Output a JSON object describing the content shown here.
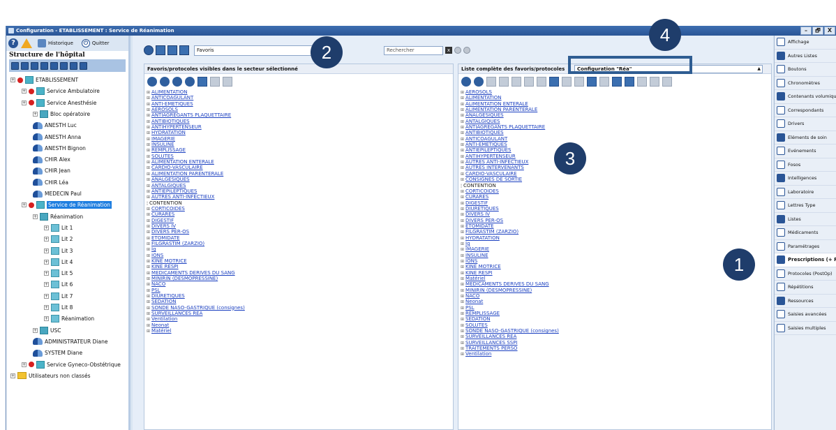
{
  "window": {
    "title": "Configuration - ETABLISSEMENT : Service de Réanimation",
    "controls": [
      "–",
      "🗗",
      "X"
    ]
  },
  "toolbar": {
    "historique": "Historique",
    "quitter": "Quitter"
  },
  "left": {
    "structure_label": "Structure de l'hôpital",
    "tree": [
      {
        "label": "ETABLISSEMENT",
        "level": 0,
        "icon": "hospital"
      },
      {
        "label": "Service Ambulatoire",
        "level": 1,
        "icon": "building"
      },
      {
        "label": "Service Anesthésie",
        "level": 1,
        "icon": "building"
      },
      {
        "label": "Bloc opératoire",
        "level": 2,
        "icon": "room"
      },
      {
        "label": "ANESTH Luc",
        "level": 2,
        "icon": "user"
      },
      {
        "label": "ANESTH Anna",
        "level": 2,
        "icon": "user"
      },
      {
        "label": "ANESTH Bignon",
        "level": 2,
        "icon": "user"
      },
      {
        "label": "CHIR Alex",
        "level": 2,
        "icon": "user"
      },
      {
        "label": "CHIR Jean",
        "level": 2,
        "icon": "user"
      },
      {
        "label": "CHIR Léa",
        "level": 2,
        "icon": "user"
      },
      {
        "label": "MEDECIN Paul",
        "level": 2,
        "icon": "user"
      },
      {
        "label": "Service de Réanimation",
        "level": 1,
        "icon": "building",
        "selected": true
      },
      {
        "label": "Réanimation",
        "level": 2,
        "icon": "room"
      },
      {
        "label": "Lit 1",
        "level": 3,
        "icon": "bed"
      },
      {
        "label": "Lit 2",
        "level": 3,
        "icon": "bed"
      },
      {
        "label": "Lit 3",
        "level": 3,
        "icon": "bed"
      },
      {
        "label": "Lit 4",
        "level": 3,
        "icon": "bed"
      },
      {
        "label": "Lit 5",
        "level": 3,
        "icon": "bed"
      },
      {
        "label": "Lit 6",
        "level": 3,
        "icon": "bed"
      },
      {
        "label": "Lit 7",
        "level": 3,
        "icon": "bed"
      },
      {
        "label": "Lit 8",
        "level": 3,
        "icon": "bed"
      },
      {
        "label": "Réanimation",
        "level": 3,
        "icon": "bed"
      },
      {
        "label": "USC",
        "level": 2,
        "icon": "room"
      },
      {
        "label": "ADMINISTRATEUR Diane",
        "level": 2,
        "icon": "user"
      },
      {
        "label": "SYSTEM Diane",
        "level": 2,
        "icon": "user"
      },
      {
        "label": "Service Gyneco-Obstétrique",
        "level": 1,
        "icon": "building"
      },
      {
        "label": "Utilisateurs non classés",
        "level": 0,
        "icon": "folder"
      }
    ]
  },
  "center": {
    "favoris_value": "Favoris",
    "search_placeholder": "Rechercher",
    "left_panel_title": "Favoris/protocoles visibles dans le secteur sélectionné",
    "right_panel_title": "Liste complète des favoris/protocoles",
    "config_value": "Configuration \"Réa\"",
    "left_items": [
      "ALIMENTATION",
      "ANTICOAGULANT",
      "ANTI-EMETIQUES",
      "AEROSOLS",
      "ANTIAGREGANTS PLAQUETTAIRE",
      "ANTIBIOTIQUES",
      "ANTIHYPERTENSEUR",
      "HYDRATATION",
      "IMAGERIE",
      "INSULINE",
      "REMPLISSAGE",
      "SOLUTES",
      "ALIMENTATION ENTERALE",
      "CARDIO-VASCULAIRE",
      "ALIMENTATION PARENTERALE",
      "ANALGESIQUES",
      "ANTALGIQUES",
      "ANTIEPILEPTIQUES",
      "AUTRES ANTI-INFECTIEUX",
      "CONTENTION",
      "CORTICOIDES",
      "CURARES",
      "DIGESTIF",
      "DIVERS IV",
      "DIVERS PER-OS",
      "ETOMIDATE",
      "FILGRASTIM (ZARZIO)",
      "Ig",
      "IONS",
      "KINE MOTRICE",
      "KINE RESPI",
      "MEDICAMENTS DERIVES DU SANG",
      "MINIRIN (DESMOPRESSINE)",
      "NACO",
      "PSL",
      "DIURETIQUES",
      "SEDATION",
      "SONDE NASO-GASTRIQUE (consignes)",
      "SURVEILLANCES REA",
      "Ventilation",
      "Neonat",
      "Matériel"
    ],
    "right_items": [
      "AEROSOLS",
      "ALIMENTATION",
      "ALIMENTATION ENTERALE",
      "ALIMENTATION PARENTERALE",
      "ANALGESIQUES",
      "ANTALGIQUES",
      "ANTIAGREGANTS PLAQUETTAIRE",
      "ANTIBIOTIQUES",
      "ANTICOAGULANT",
      "ANTI-EMETIQUES",
      "ANTIEPILEPTIQUES",
      "ANTIHYPERTENSEUR",
      "AUTRES ANTI-INFECTIEUX",
      "AUTRES INTERVENANTS",
      "CARDIO-VASCULAIRE",
      "CONSIGNES DE SORTIE",
      "CONTENTION",
      "CORTICOIDES",
      "CURARES",
      "DIGESTIF",
      "DIURETIQUES",
      "DIVERS IV",
      "DIVERS PER-OS",
      "ETOMIDATE",
      "FILGRASTIM (ZARZIO)",
      "HYDRATATION",
      "Ig",
      "IMAGERIE",
      "INSULINE",
      "IONS",
      "KINE MOTRICE",
      "KINE RESPI",
      "Matériel",
      "MEDICAMENTS DERIVES DU SANG",
      "MINIRIN (DESMOPRESSINE)",
      "NACO",
      "Neonat",
      "PSL",
      "REMPLISSAGE",
      "SEDATION",
      "SOLUTES",
      "SONDE NASO-GASTRIQUE (consignes)",
      "SURVEILLANCES REA",
      "SURVEILLANCES SSPI",
      "TRAITEMENTS PERSO",
      "Ventilation"
    ]
  },
  "right": {
    "items": [
      "Affichage",
      "Autres Listes",
      "Boutons",
      "Chronomètres",
      "Contenants volumiques",
      "Correspondants",
      "Drivers",
      "Eléments de soin",
      "Evénements",
      "Fosos",
      "Intelligences",
      "Laboratoire",
      "Lettres Type",
      "Listes",
      "Médicaments",
      "Paramétrages",
      "Prescriptions (+ Favoris)",
      "Protocoles (PostOp)",
      "Répétitions",
      "Ressources",
      "Saisies avancées",
      "Saisies multiples"
    ],
    "active_index": 16
  },
  "annotations": [
    "1",
    "2",
    "3",
    "4"
  ]
}
